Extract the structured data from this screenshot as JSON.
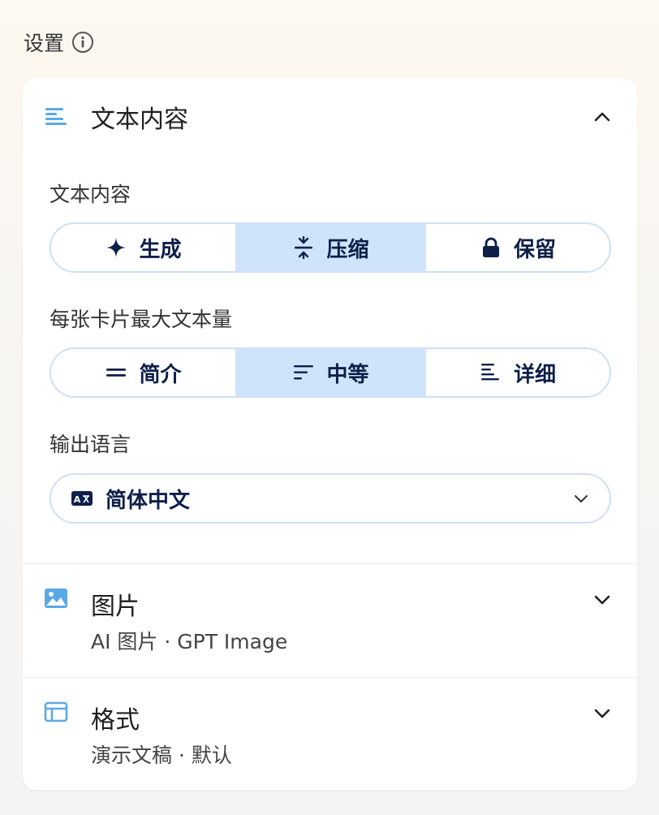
{
  "header": {
    "title": "设置",
    "icon": "info-icon"
  },
  "text_section": {
    "title": "文本内容",
    "icon": "text-lines-icon",
    "expanded": true,
    "content_label": "文本内容",
    "content_options": [
      {
        "label": "生成",
        "icon": "sparkle-icon",
        "selected": false
      },
      {
        "label": "压缩",
        "icon": "compress-icon",
        "selected": true
      },
      {
        "label": "保留",
        "icon": "lock-icon",
        "selected": false
      }
    ],
    "amount_label": "每张卡片最大文本量",
    "amount_options": [
      {
        "label": "简介",
        "icon": "two-lines-icon",
        "selected": false
      },
      {
        "label": "中等",
        "icon": "medium-lines-icon",
        "selected": true
      },
      {
        "label": "详细",
        "icon": "many-lines-icon",
        "selected": false
      }
    ],
    "language_label": "输出语言",
    "language_value": "简体中文",
    "language_icon": "translate-icon"
  },
  "image_section": {
    "title": "图片",
    "subtitle": "AI 图片 · GPT Image",
    "icon": "image-icon",
    "expanded": false
  },
  "format_section": {
    "title": "格式",
    "subtitle": "演示文稿 · 默认",
    "icon": "layout-icon",
    "expanded": false
  },
  "colors": {
    "accent": "#5aa9e6",
    "selected_bg": "#cfe3fb",
    "dark_text": "#0e1f4a",
    "border": "#cfe0f2"
  }
}
